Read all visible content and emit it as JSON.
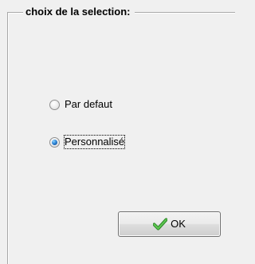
{
  "group": {
    "title": "choix de la selection:"
  },
  "options": [
    {
      "label": "Par defaut",
      "selected": false
    },
    {
      "label": "Personnalisé",
      "selected": true
    }
  ],
  "ok_button": {
    "label": "OK",
    "icon": "checkmark-icon",
    "icon_color": "#3aa335"
  }
}
